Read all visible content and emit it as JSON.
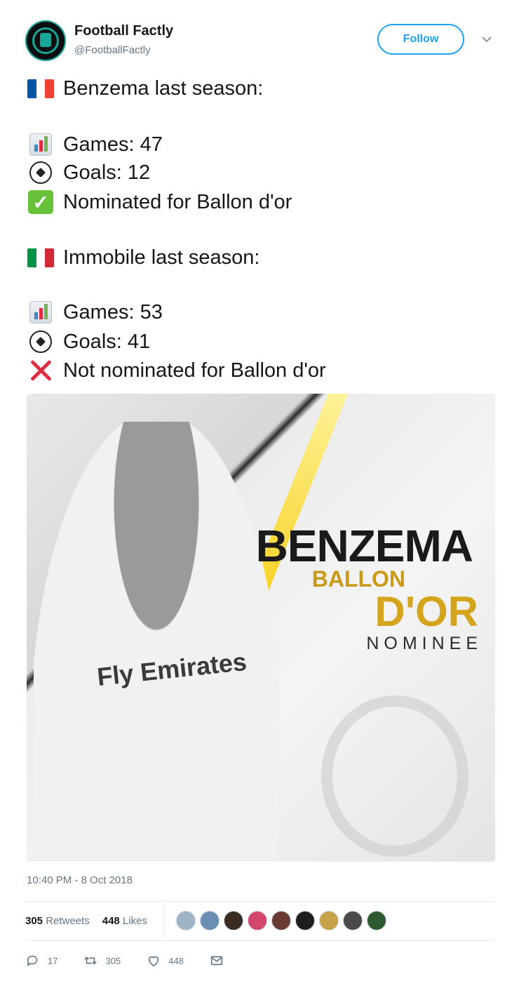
{
  "header": {
    "display_name": "Football Factly",
    "handle": "@FootballFactly",
    "follow_label": "Follow"
  },
  "tweet": {
    "lines": [
      "Benzema last season:",
      "Games: 47",
      "Goals: 12",
      "Nominated for Ballon d'or",
      "Immobile last season:",
      "Games: 53",
      "Goals: 41",
      "Not nominated for Ballon d'or"
    ]
  },
  "media": {
    "headline": "BENZEMA",
    "sub1": "BALLON",
    "sub2": "D'OR",
    "sub3": "NOMINEE",
    "jersey_text": "Fly Emirates"
  },
  "meta": {
    "timestamp": "10:40 PM - 8 Oct 2018",
    "retweets_count": "305",
    "retweets_label": "Retweets",
    "likes_count": "448",
    "likes_label": "Likes"
  },
  "actions": {
    "reply_count": "17",
    "retweet_count": "305",
    "like_count": "448"
  },
  "colors": {
    "accent": "#1da1f2",
    "brand": "#17a79a",
    "gold": "#d4a51c"
  }
}
